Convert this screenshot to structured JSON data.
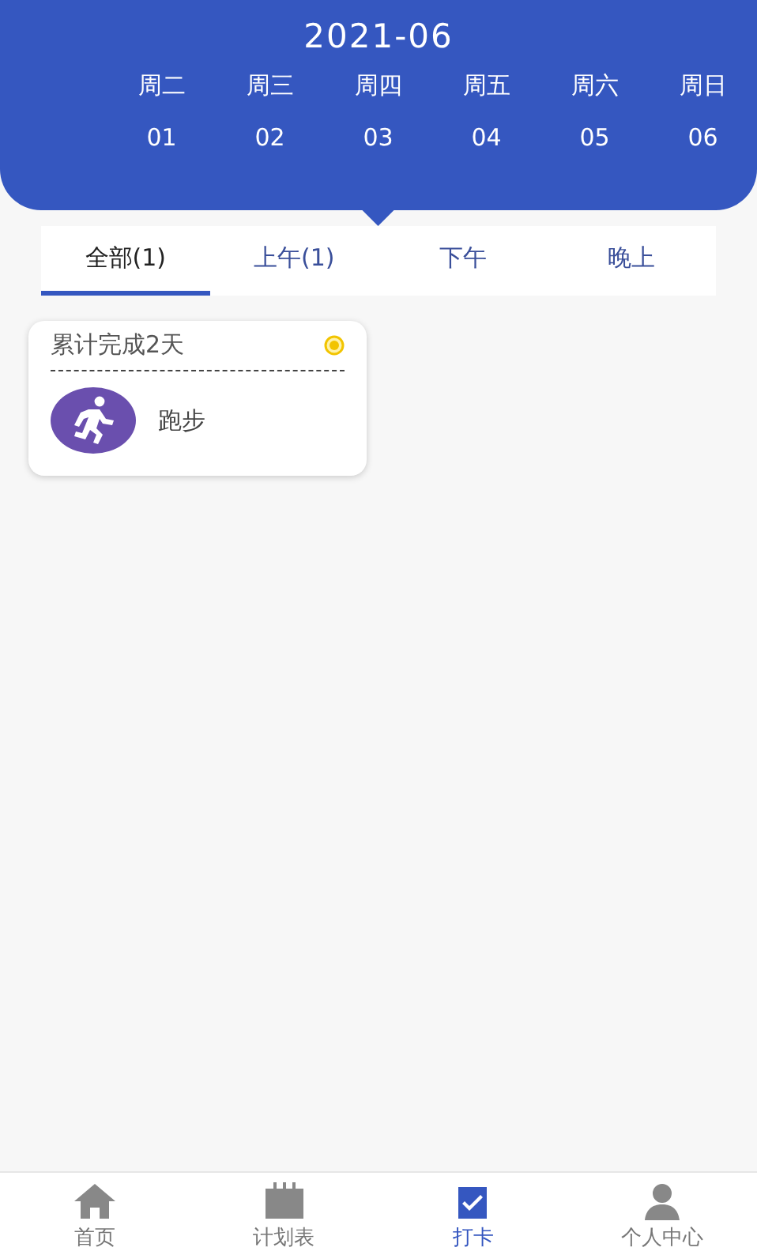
{
  "header": {
    "month": "2021-06"
  },
  "days": [
    {
      "weekday": "周二",
      "date": "01",
      "selected": false
    },
    {
      "weekday": "周三",
      "date": "02",
      "selected": false
    },
    {
      "weekday": "周四",
      "date": "03",
      "selected": true
    },
    {
      "weekday": "周五",
      "date": "04",
      "selected": false
    },
    {
      "weekday": "周六",
      "date": "05",
      "selected": false
    },
    {
      "weekday": "周日",
      "date": "06",
      "selected": false
    }
  ],
  "tabs": [
    {
      "label": "全部(1)",
      "selected": true
    },
    {
      "label": "上午(1)",
      "selected": false
    },
    {
      "label": "下午",
      "selected": false
    },
    {
      "label": "晚上",
      "selected": false
    }
  ],
  "cards": [
    {
      "summary": "累计完成2天",
      "habit": "跑步",
      "kind": "running"
    }
  ],
  "bottom_nav": [
    {
      "label": "首页",
      "kind": "home",
      "selected": false
    },
    {
      "label": "计划表",
      "kind": "calendar",
      "selected": false
    },
    {
      "label": "打卡",
      "kind": "checkin",
      "selected": true
    },
    {
      "label": "个人中心",
      "kind": "person",
      "selected": false
    }
  ]
}
